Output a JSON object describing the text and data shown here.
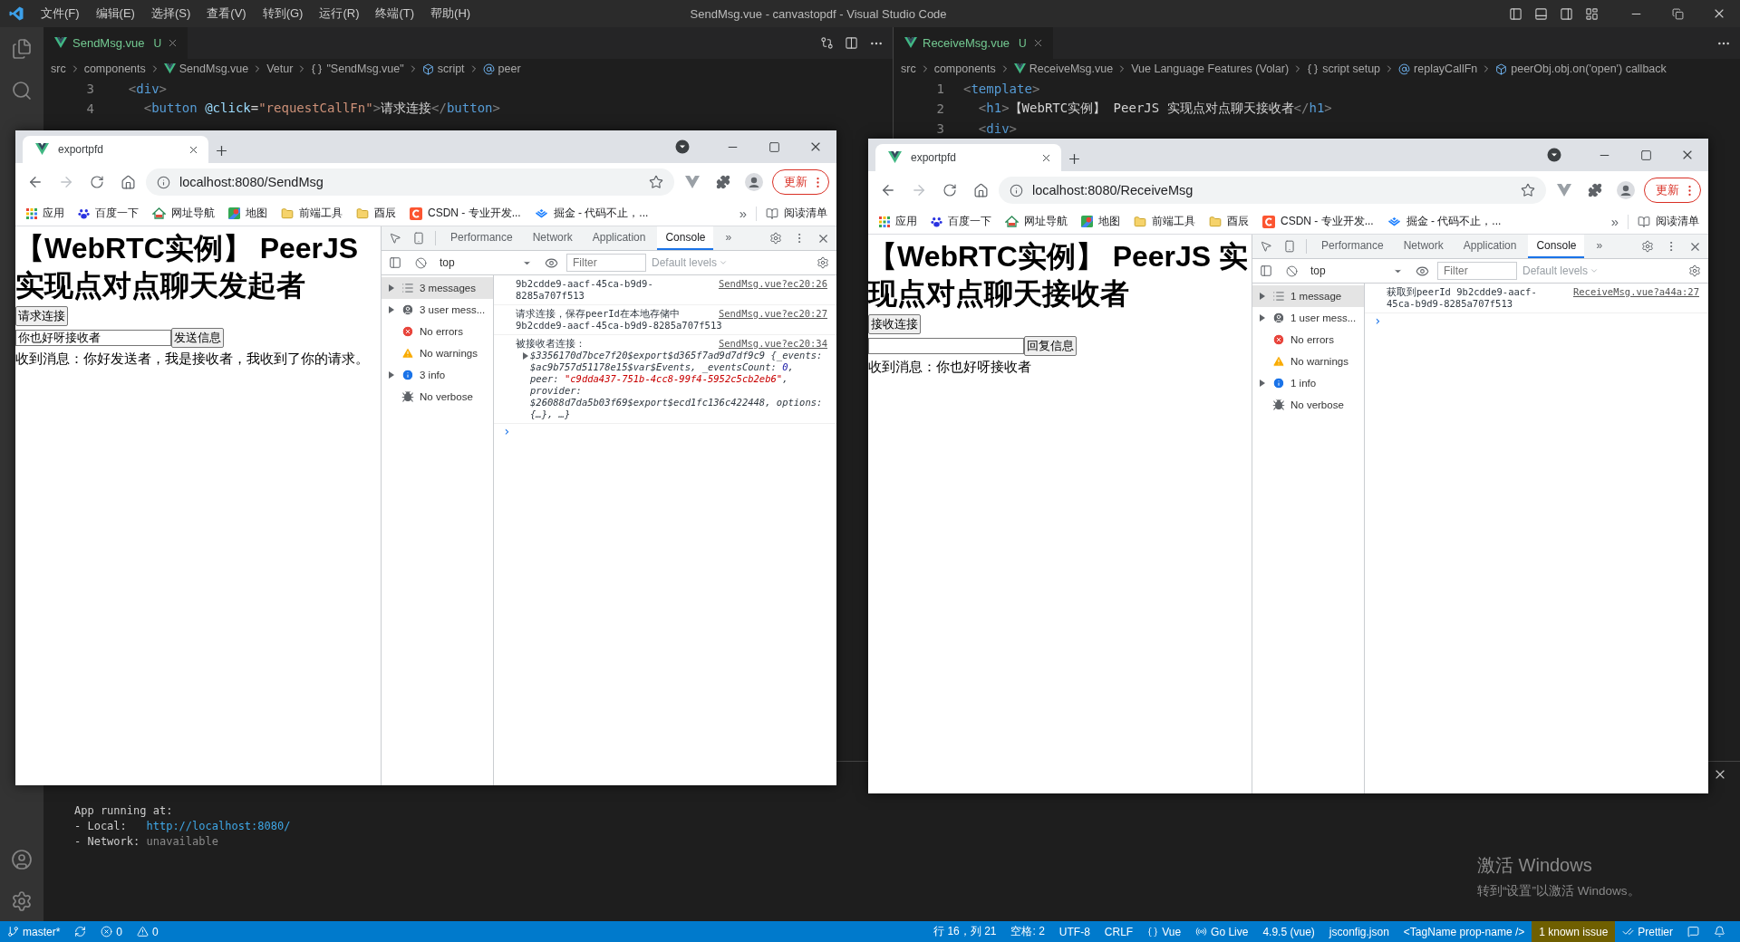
{
  "title_bar": {
    "menu": [
      "文件(F)",
      "编辑(E)",
      "选择(S)",
      "查看(V)",
      "转到(G)",
      "运行(R)",
      "终端(T)",
      "帮助(H)"
    ],
    "title": "SendMsg.vue - canvastopdf - Visual Studio Code"
  },
  "editor_groups": [
    {
      "tabs": [
        {
          "label": "SendMsg.vue",
          "badge": "U",
          "selected": true
        }
      ],
      "breadcrumbs": [
        {
          "kind": "text",
          "text": "src"
        },
        {
          "kind": "text",
          "text": "components"
        },
        {
          "kind": "vue",
          "text": "SendMsg.vue"
        },
        {
          "kind": "text",
          "text": "Vetur"
        },
        {
          "kind": "braces",
          "text": "\"SendMsg.vue\""
        },
        {
          "kind": "module",
          "text": "script"
        },
        {
          "kind": "variable",
          "text": "peer"
        }
      ],
      "lines": [
        {
          "number": "3",
          "tokens": [
            {
              "kind": "punct",
              "text": "  <"
            },
            {
              "kind": "tag",
              "text": "div"
            },
            {
              "kind": "punct",
              "text": ">"
            }
          ]
        },
        {
          "number": "4",
          "tokens": [
            {
              "kind": "punct",
              "text": "    <"
            },
            {
              "kind": "tag",
              "text": "button"
            },
            {
              "kind": "attr",
              "text": " @click"
            },
            {
              "kind": "plain",
              "text": "="
            },
            {
              "kind": "string",
              "text": "\"requestCallFn\""
            },
            {
              "kind": "punct",
              "text": ">"
            },
            {
              "kind": "plain",
              "text": "请求连接"
            },
            {
              "kind": "punct",
              "text": "</"
            },
            {
              "kind": "tag",
              "text": "button"
            },
            {
              "kind": "punct",
              "text": ">"
            }
          ]
        }
      ]
    },
    {
      "tabs": [
        {
          "label": "ReceiveMsg.vue",
          "badge": "U",
          "selected": true
        }
      ],
      "breadcrumbs": [
        {
          "kind": "text",
          "text": "src"
        },
        {
          "kind": "text",
          "text": "components"
        },
        {
          "kind": "vue",
          "text": "ReceiveMsg.vue"
        },
        {
          "kind": "text",
          "text": "Vue Language Features (Volar)"
        },
        {
          "kind": "braces",
          "text": "script setup"
        },
        {
          "kind": "variable",
          "text": "replayCallFn"
        },
        {
          "kind": "module",
          "text": "peerObj.obj.on('open') callback"
        }
      ],
      "lines": [
        {
          "number": "1",
          "tokens": [
            {
              "kind": "punct",
              "text": "<"
            },
            {
              "kind": "tag",
              "text": "template"
            },
            {
              "kind": "punct",
              "text": ">"
            }
          ]
        },
        {
          "number": "2",
          "tokens": [
            {
              "kind": "punct",
              "text": "  <"
            },
            {
              "kind": "tag",
              "text": "h1"
            },
            {
              "kind": "punct",
              "text": ">"
            },
            {
              "kind": "plain",
              "text": "【WebRTC实例】 PeerJS 实现点对点聊天接收者"
            },
            {
              "kind": "punct",
              "text": "</"
            },
            {
              "kind": "tag",
              "text": "h1"
            },
            {
              "kind": "punct",
              "text": ">"
            }
          ]
        },
        {
          "number": "3",
          "tokens": [
            {
              "kind": "punct",
              "text": "  <"
            },
            {
              "kind": "tag",
              "text": "div"
            },
            {
              "kind": "punct",
              "text": ">"
            }
          ]
        }
      ]
    }
  ],
  "browsers": [
    {
      "tab_title": "exportpfd",
      "url": "localhost:8080/SendMsg",
      "update_button": "更新",
      "bookmarks": [
        {
          "kind": "apps",
          "label": "应用"
        },
        {
          "kind": "baidu",
          "label": "百度一下"
        },
        {
          "kind": "nav",
          "label": "网址导航"
        },
        {
          "kind": "maps",
          "label": "地图"
        },
        {
          "kind": "folder",
          "label": "前端工具"
        },
        {
          "kind": "folder",
          "label": "酉辰"
        },
        {
          "kind": "csdn",
          "label": "CSDN - 专业开发..."
        },
        {
          "kind": "juejin",
          "label": "掘金 - 代码不止，..."
        }
      ],
      "more_bookmarks": "»",
      "reading_list": "阅读清单",
      "page": {
        "heading": "【WebRTC实例】 PeerJS 实现点对点聊天发起者",
        "connect_button": "请求连接",
        "input_value": "你也好呀接收者",
        "send_button": "发送信息",
        "received": "收到消息：你好发送者，我是接收者，我收到了你的请求。"
      },
      "devtools": {
        "tabs": [
          {
            "label": "Performance",
            "selected": false
          },
          {
            "label": "Network",
            "selected": false
          },
          {
            "label": "Application",
            "selected": false
          },
          {
            "label": "Console",
            "selected": true
          }
        ],
        "more_tabs": "»",
        "context": "top",
        "filter_placeholder": "Filter",
        "levels": "Default levels",
        "sidebar": [
          {
            "kind": "messages",
            "label": "3 messages",
            "expandable": true,
            "selected": true
          },
          {
            "kind": "user",
            "label": "3 user mess...",
            "expandable": true,
            "selected": false
          },
          {
            "kind": "errors",
            "label": "No errors",
            "expandable": false,
            "selected": false
          },
          {
            "kind": "warnings",
            "label": "No warnings",
            "expandable": false,
            "selected": false
          },
          {
            "kind": "info",
            "label": "3 info",
            "expandable": true,
            "selected": false
          },
          {
            "kind": "verbose",
            "label": "No verbose",
            "expandable": false,
            "selected": false
          }
        ],
        "messages": [
          {
            "text": "9b2cdde9-aacf-45ca-b9d9-8285a707f513",
            "source": "SendMsg.vue?ec20:26"
          },
          {
            "text": "请求连接，保存peerId在本地存储中 9b2cdde9-aacf-45ca-b9d9-8285a707f513",
            "source": "SendMsg.vue?ec20:27"
          },
          {
            "text": "被接收者连接：",
            "source": "SendMsg.vue?ec20:34",
            "object": [
              {
                "kind": "plain",
                "text": "$3356170d7bce7f20$export$d365f7ad9d7df9c9 {_events: $ac9b757d51178e15$var$Events, _eventsCount: "
              },
              {
                "kind": "number",
                "text": "0"
              },
              {
                "kind": "plain",
                "text": ", peer: "
              },
              {
                "kind": "string",
                "text": "\"c9dda437-751b-4cc8-99f4-5952c5cb2eb6\""
              },
              {
                "kind": "plain",
                "text": ", provider: $26088d7da5b03f69$export$ecd1fc136c422448, options: {…}, …}"
              }
            ]
          }
        ],
        "prompt": "›"
      }
    },
    {
      "tab_title": "exportpfd",
      "url": "localhost:8080/ReceiveMsg",
      "update_button": "更新",
      "bookmarks": [
        {
          "kind": "apps",
          "label": "应用"
        },
        {
          "kind": "baidu",
          "label": "百度一下"
        },
        {
          "kind": "nav",
          "label": "网址导航"
        },
        {
          "kind": "maps",
          "label": "地图"
        },
        {
          "kind": "folder",
          "label": "前端工具"
        },
        {
          "kind": "folder",
          "label": "酉辰"
        },
        {
          "kind": "csdn",
          "label": "CSDN - 专业开发..."
        },
        {
          "kind": "juejin",
          "label": "掘金 - 代码不止，..."
        }
      ],
      "more_bookmarks": "»",
      "reading_list": "阅读清单",
      "page": {
        "heading": "【WebRTC实例】 PeerJS 实现点对点聊天接收者",
        "connect_button": "接收连接",
        "send_button": "回复信息",
        "received": "收到消息：你也好呀接收者"
      },
      "devtools": {
        "tabs": [
          {
            "label": "Performance",
            "selected": false
          },
          {
            "label": "Network",
            "selected": false
          },
          {
            "label": "Application",
            "selected": false
          },
          {
            "label": "Console",
            "selected": true
          }
        ],
        "more_tabs": "»",
        "context": "top",
        "filter_placeholder": "Filter",
        "levels": "Default levels",
        "sidebar": [
          {
            "kind": "messages",
            "label": "1 message",
            "expandable": true,
            "selected": true
          },
          {
            "kind": "user",
            "label": "1 user mess...",
            "expandable": true,
            "selected": false
          },
          {
            "kind": "errors",
            "label": "No errors",
            "expandable": false,
            "selected": false
          },
          {
            "kind": "warnings",
            "label": "No warnings",
            "expandable": false,
            "selected": false
          },
          {
            "kind": "info",
            "label": "1 info",
            "expandable": true,
            "selected": false
          },
          {
            "kind": "verbose",
            "label": "No verbose",
            "expandable": false,
            "selected": false
          }
        ],
        "messages": [
          {
            "text": "获取到peerId 9b2cdde9-aacf-45ca-b9d9-8285a707f513",
            "source": "ReceiveMsg.vue?a44a:27"
          }
        ],
        "prompt": "›"
      }
    }
  ],
  "terminal": {
    "lines": [
      [
        {
          "kind": "plain",
          "text": "App running at:"
        }
      ],
      [
        {
          "kind": "plain",
          "text": "- Local:   "
        },
        {
          "kind": "link",
          "text": "http://localhost:8080/"
        }
      ],
      [
        {
          "kind": "plain",
          "text": "- Network: "
        },
        {
          "kind": "dim",
          "text": "unavailable"
        }
      ]
    ]
  },
  "activation_notice": {
    "title": "激活 Windows",
    "hint": "转到“设置”以激活 Windows。"
  },
  "status_bar": {
    "left": [
      {
        "kind": "branch",
        "text": "master*"
      },
      {
        "kind": "sync"
      },
      {
        "kind": "errors",
        "text": "0"
      },
      {
        "kind": "warnings",
        "text": "0"
      }
    ],
    "right": [
      {
        "kind": "plain",
        "text": "行 16，列 21"
      },
      {
        "kind": "plain",
        "text": "空格: 2"
      },
      {
        "kind": "plain",
        "text": "UTF-8"
      },
      {
        "kind": "plain",
        "text": "CRLF"
      },
      {
        "kind": "language",
        "text": "Vue"
      },
      {
        "kind": "golive",
        "text": "Go Live"
      },
      {
        "kind": "plain",
        "text": "4.9.5 (vue)"
      },
      {
        "kind": "plain",
        "text": "jsconfig.json"
      },
      {
        "kind": "plain",
        "text": "<TagName prop-name />"
      },
      {
        "kind": "issue",
        "text": "1 known issue"
      },
      {
        "kind": "prettier",
        "text": "Prettier"
      },
      {
        "kind": "feedback"
      },
      {
        "kind": "bell"
      }
    ]
  }
}
